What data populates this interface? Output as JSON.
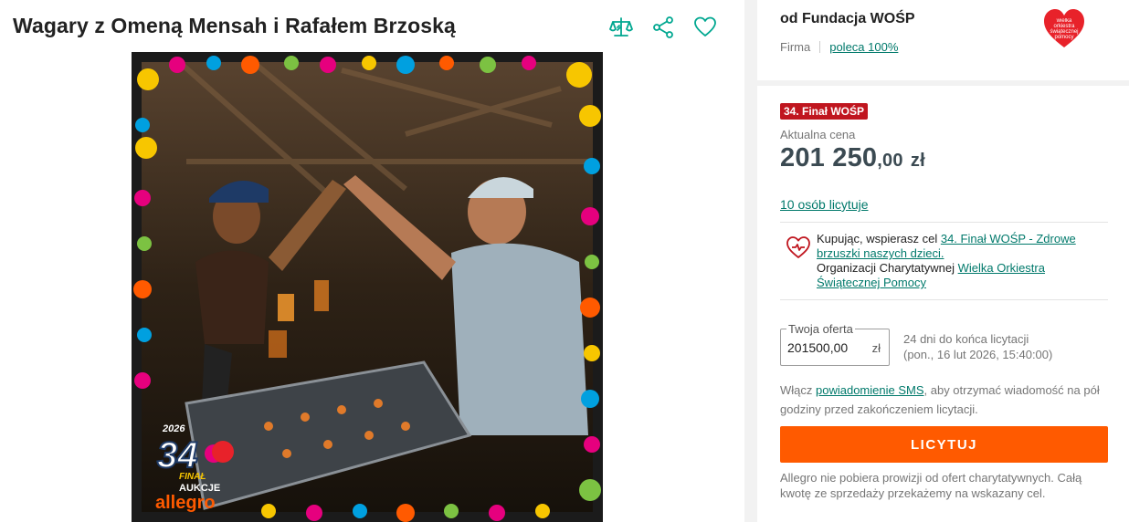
{
  "listing": {
    "title": "Wagary z Omeną Mensah i Rafałem Brzoską"
  },
  "actions": {
    "compare_icon": "scales-icon",
    "share_icon": "share-icon",
    "favorite_icon": "heart-icon"
  },
  "photo": {
    "overlay_year": "2026",
    "overlay_number": "34",
    "overlay_final": "FINAŁ",
    "overlay_aukcje": "AUKCJE",
    "overlay_brand": "allegro"
  },
  "seller": {
    "name": "od Fundacja WOŚP",
    "type": "Firma",
    "recommend": "poleca 100%",
    "logo_text": "wielka orkiestra świątecznej pomocy"
  },
  "offer": {
    "badge": "34. Finał WOŚP",
    "price_label": "Aktualna cena",
    "price_main": "201 250",
    "price_decimal": ",00",
    "price_currency": "zł",
    "bidders": "10 osób licytuje"
  },
  "charity": {
    "text_1": "Kupując, wspierasz cel ",
    "goal_link": "34. Finał WOŚP - Zdrowe brzuszki naszych dzieci.",
    "text_2": "Organizacji Charytatywnej ",
    "org_link": "Wielka Orkiestra Świątecznej Pomocy"
  },
  "bid": {
    "legend": "Twoja oferta",
    "value": "201500,00",
    "unit": "zł",
    "time_left": "24 dni do końca licytacji",
    "end_date": "(pon., 16 lut 2026, 15:40:00)"
  },
  "sms": {
    "text_1": "Włącz ",
    "link": "powiadomienie SMS",
    "text_2": ", aby otrzymać wiadomość na pół godziny przed zakończeniem licytacji."
  },
  "cta": {
    "label": "LICYTUJ"
  },
  "note": {
    "text": "Allegro nie pobiera prowizji od ofert charytatywnych. Całą kwotę ze sprzedaży przekażemy na wskazany cel."
  },
  "colors": {
    "accent": "#00796b",
    "cta": "#ff5a00",
    "badge": "#c0161f",
    "price": "#3b4a52"
  }
}
